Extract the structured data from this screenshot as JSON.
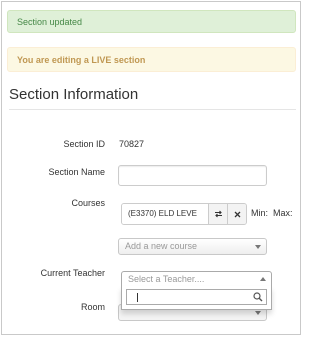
{
  "alerts": {
    "success": "Section updated",
    "warning": "You are editing a LIVE section"
  },
  "section": {
    "title": "Section Information"
  },
  "fields": {
    "section_id_label": "Section ID",
    "section_id_value": "70827",
    "section_name_label": "Section Name",
    "section_name_value": "",
    "courses_label": "Courses",
    "course_tag": "(E3370) ELD LEVE",
    "course_min_label": "Min:",
    "course_max_label": "Max:",
    "add_course_placeholder": "Add a new course",
    "teacher_label": "Current Teacher",
    "teacher_placeholder": "Select a Teacher....",
    "teacher_search_value": "",
    "room_label": "Room"
  },
  "icons": {
    "swap": "swap-icon",
    "remove": "close-icon",
    "search": "search-icon",
    "dropdown": "chevron-down-icon"
  },
  "colors": {
    "success_bg": "#dff0d8",
    "success_text": "#468847",
    "warning_bg": "#fcf8e3",
    "warning_text": "#c09853"
  }
}
